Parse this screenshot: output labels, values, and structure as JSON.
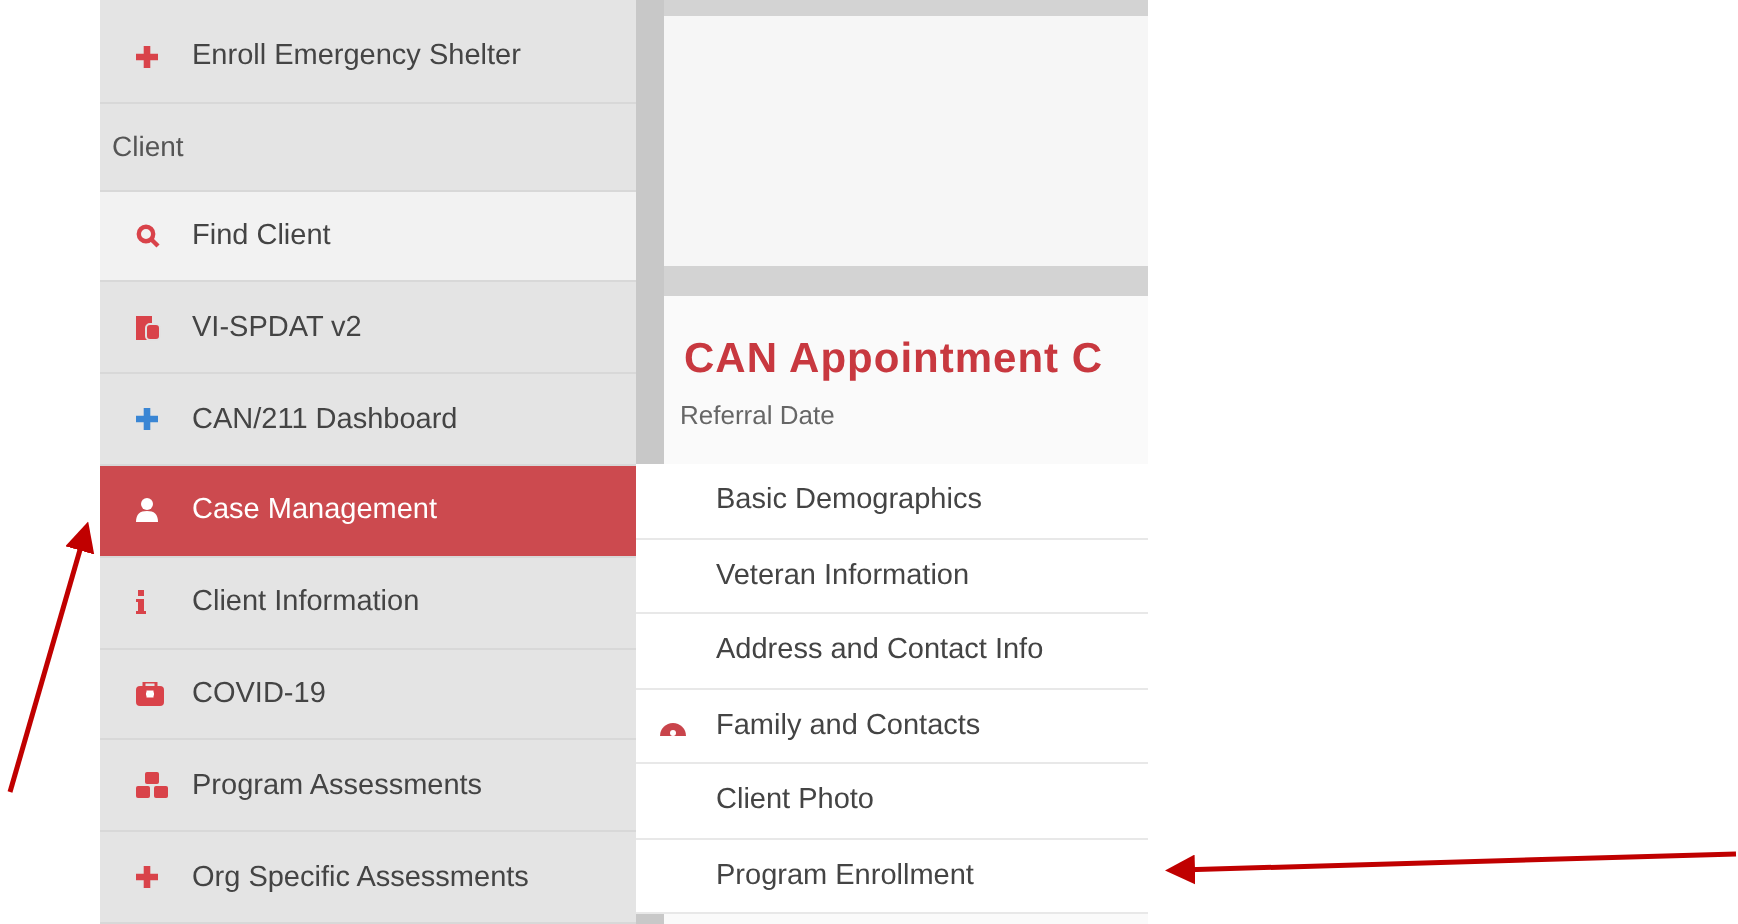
{
  "sidebar": {
    "items": [
      {
        "kind": "item",
        "label": "Enroll Emergency Shelter",
        "selected": false,
        "hovered": false
      },
      {
        "kind": "header",
        "label": "Client"
      },
      {
        "kind": "item",
        "label": "Find Client",
        "selected": false,
        "hovered": true
      },
      {
        "kind": "item",
        "label": "VI-SPDAT v2",
        "selected": false,
        "hovered": false
      },
      {
        "kind": "item",
        "label": "CAN/211 Dashboard",
        "selected": false,
        "hovered": false
      },
      {
        "kind": "item",
        "label": "Case Management",
        "selected": true,
        "hovered": false
      },
      {
        "kind": "item",
        "label": "Client Information",
        "selected": false,
        "hovered": false
      },
      {
        "kind": "item",
        "label": "COVID-19",
        "selected": false,
        "hovered": false
      },
      {
        "kind": "item",
        "label": "Program Assessments",
        "selected": false,
        "hovered": false
      },
      {
        "kind": "item",
        "label": "Org Specific Assessments",
        "selected": false,
        "hovered": false
      }
    ]
  },
  "card": {
    "title": "CAN Appointment C",
    "field_label": "Referral Date"
  },
  "submenu": {
    "items": [
      {
        "label": "Basic Demographics"
      },
      {
        "label": "Veteran Information"
      },
      {
        "label": "Address and Contact Info"
      },
      {
        "label": "Family and Contacts"
      },
      {
        "label": "Client Photo"
      },
      {
        "label": "Program Enrollment"
      }
    ]
  }
}
